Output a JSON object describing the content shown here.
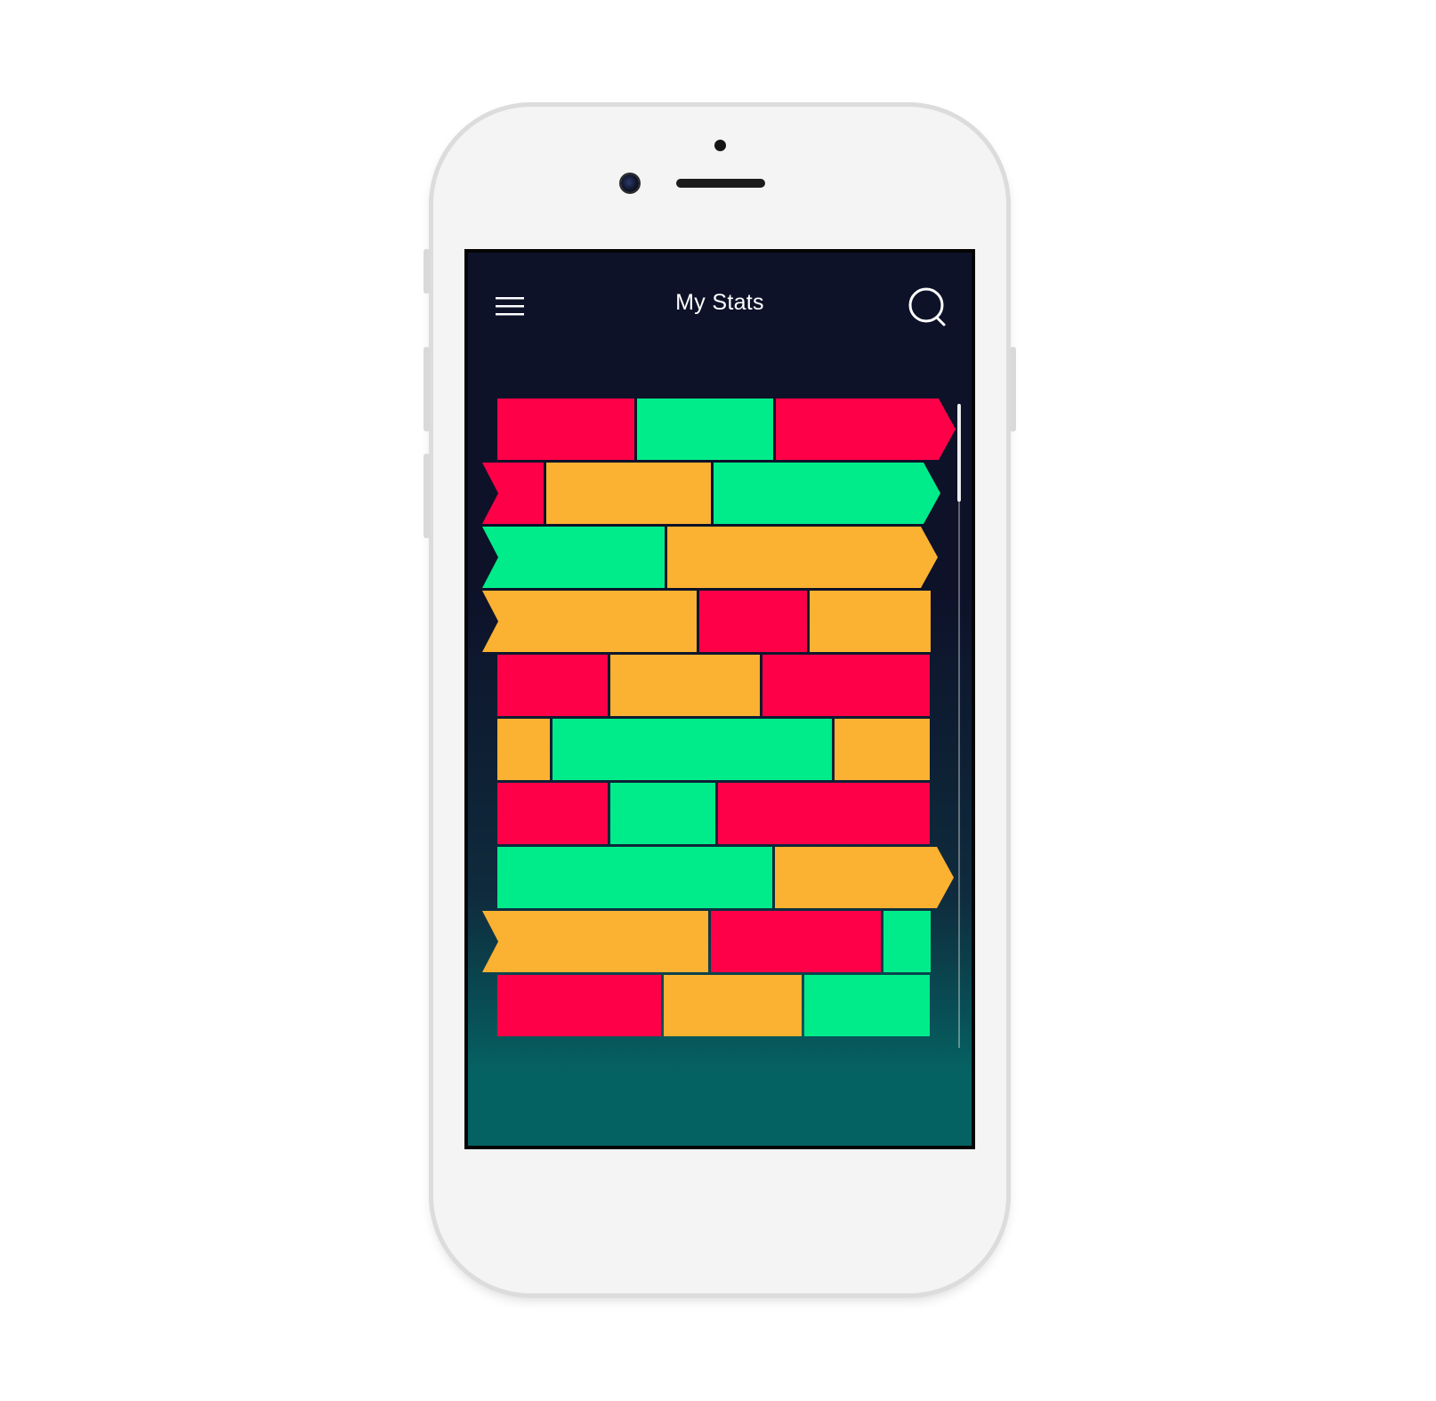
{
  "header": {
    "title": "My Stats",
    "menu_icon": "hamburger-menu-icon",
    "search_icon": "search-icon"
  },
  "colors": {
    "red": "#fe0048",
    "green": "#00ec8b",
    "orange": "#fbb131",
    "screen_top": "#0d1229",
    "screen_bottom": "#056262"
  },
  "blocks": {
    "rows": [
      {
        "left": "flat",
        "right": "arrow",
        "blocks": [
          {
            "color": "red",
            "width": 154
          },
          {
            "color": "green",
            "width": 153
          },
          {
            "color": "red",
            "width": 183
          }
        ]
      },
      {
        "left": "notch",
        "right": "arrow",
        "blocks": [
          {
            "color": "red",
            "width": 69
          },
          {
            "color": "orange",
            "width": 185
          },
          {
            "color": "green",
            "width": 236
          }
        ]
      },
      {
        "left": "notch",
        "right": "arrow",
        "blocks": [
          {
            "color": "green",
            "width": 205
          },
          {
            "color": "orange",
            "width": 285
          }
        ]
      },
      {
        "left": "notch",
        "right": "flat",
        "blocks": [
          {
            "color": "orange",
            "width": 241
          },
          {
            "color": "red",
            "width": 121
          },
          {
            "color": "orange",
            "width": 136
          }
        ]
      },
      {
        "left": "flat",
        "right": "flat",
        "blocks": [
          {
            "color": "red",
            "width": 124
          },
          {
            "color": "orange",
            "width": 168
          },
          {
            "color": "red",
            "width": 188
          }
        ]
      },
      {
        "left": "flat",
        "right": "flat",
        "blocks": [
          {
            "color": "orange",
            "width": 59
          },
          {
            "color": "green",
            "width": 314
          },
          {
            "color": "orange",
            "width": 107
          }
        ]
      },
      {
        "left": "flat",
        "right": "flat",
        "blocks": [
          {
            "color": "red",
            "width": 124
          },
          {
            "color": "green",
            "width": 118
          },
          {
            "color": "red",
            "width": 238
          }
        ]
      },
      {
        "left": "flat",
        "right": "arrow",
        "blocks": [
          {
            "color": "green",
            "width": 309
          },
          {
            "color": "orange",
            "width": 182
          }
        ]
      },
      {
        "left": "notch",
        "right": "flat",
        "blocks": [
          {
            "color": "orange",
            "width": 254
          },
          {
            "color": "red",
            "width": 191
          },
          {
            "color": "green",
            "width": 53
          }
        ]
      },
      {
        "left": "flat",
        "right": "flat",
        "blocks": [
          {
            "color": "red",
            "width": 184
          },
          {
            "color": "orange",
            "width": 155
          },
          {
            "color": "green",
            "width": 141
          }
        ]
      }
    ]
  },
  "scroll": {
    "position": 0
  }
}
